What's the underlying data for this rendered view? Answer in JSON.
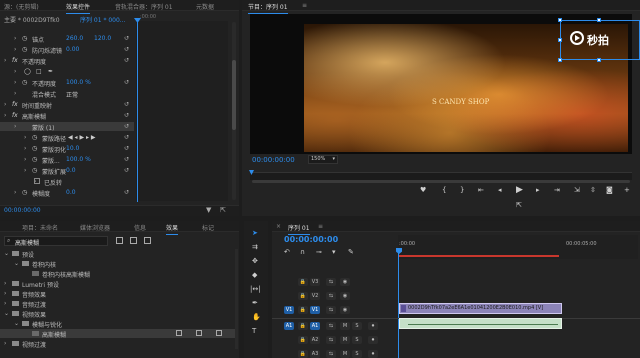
{
  "effect_controls": {
    "tabs": [
      "源：(无剪辑)",
      "效果控件",
      "音轨混合器：序列 01",
      "元数据"
    ],
    "source_label": "主要 * 0002D9Tfk0",
    "sequence_label": "序列 01 * 000...",
    "ruler_start": ":00:00",
    "rows": [
      {
        "indent": 14,
        "label": "锚点",
        "v1": "260.0",
        "v2": "120.0",
        "kind": "param"
      },
      {
        "indent": 14,
        "label": "防闪烁滤镜",
        "v1": "0.00",
        "v2": "",
        "kind": "param"
      },
      {
        "indent": 4,
        "label": "不透明度",
        "v1": "",
        "v2": "",
        "kind": "fx"
      },
      {
        "indent": 14,
        "label": "",
        "v1": "",
        "v2": "",
        "kind": "shapes"
      },
      {
        "indent": 14,
        "label": "不透明度",
        "v1": "100.0 %",
        "v2": "",
        "kind": "param"
      },
      {
        "indent": 14,
        "label": "混合模式",
        "v1": "正常",
        "v2": "",
        "kind": "dropdown"
      },
      {
        "indent": 4,
        "label": "时间重映射",
        "v1": "",
        "v2": "",
        "kind": "fx"
      },
      {
        "indent": 4,
        "label": "高斯模糊",
        "v1": "",
        "v2": "",
        "kind": "fx"
      },
      {
        "indent": 14,
        "label": "蒙版 (1)",
        "v1": "",
        "v2": "",
        "kind": "mask"
      },
      {
        "indent": 24,
        "label": "蒙版路径",
        "v1": "",
        "v2": "",
        "kind": "maskpath"
      },
      {
        "indent": 24,
        "label": "蒙版羽化",
        "v1": "10.0",
        "v2": "",
        "kind": "param"
      },
      {
        "indent": 24,
        "label": "蒙版...",
        "v1": "100.0 %",
        "v2": "",
        "kind": "param"
      },
      {
        "indent": 24,
        "label": "蒙版扩展",
        "v1": "0.0",
        "v2": "",
        "kind": "param"
      },
      {
        "indent": 34,
        "label": "已反转",
        "v1": "",
        "v2": "",
        "kind": "checkbox"
      },
      {
        "indent": 14,
        "label": "模糊度",
        "v1": "0.0",
        "v2": "",
        "kind": "param"
      }
    ],
    "bottom_time": "00:00:00:00"
  },
  "program_monitor": {
    "tab": "节目：序列 01",
    "timecode": "00:00:00:00",
    "zoom": "150%",
    "overlay_text": "S CANDY SHOP",
    "watermark_text": "秒拍"
  },
  "project_panel": {
    "tabs": [
      "项目：未命名",
      "媒体浏览器",
      "信息",
      "效果",
      "标记"
    ],
    "search_value": "高斯模糊",
    "tree": [
      {
        "indent": 4,
        "label": "预设",
        "level": 0,
        "open": true
      },
      {
        "indent": 14,
        "label": "卷积内核",
        "level": 1,
        "open": true
      },
      {
        "indent": 24,
        "label": "卷积内核高斯模糊",
        "level": 2,
        "open": false
      },
      {
        "indent": 4,
        "label": "Lumetri 预设",
        "level": 0,
        "open": false
      },
      {
        "indent": 4,
        "label": "音频效果",
        "level": 0,
        "open": false
      },
      {
        "indent": 4,
        "label": "音频过渡",
        "level": 0,
        "open": false
      },
      {
        "indent": 4,
        "label": "视频效果",
        "level": 0,
        "open": true
      },
      {
        "indent": 14,
        "label": "模糊与锐化",
        "level": 1,
        "open": true
      },
      {
        "indent": 24,
        "label": "高斯模糊",
        "level": 2,
        "open": false,
        "selected": true
      },
      {
        "indent": 4,
        "label": "视频过渡",
        "level": 0,
        "open": false
      }
    ]
  },
  "timeline": {
    "tab": "序列 01",
    "timecode": "00:00:00:00",
    "ruler_labels": [
      ":00:00",
      "00:00:05:00"
    ],
    "tracks": [
      {
        "name": "V3",
        "type": "video"
      },
      {
        "name": "V2",
        "type": "video"
      },
      {
        "name": "V1",
        "type": "video",
        "src": "V1"
      },
      {
        "name": "A1",
        "type": "audio",
        "src": "A1"
      },
      {
        "name": "A2",
        "type": "audio"
      },
      {
        "name": "A3",
        "type": "audio"
      }
    ],
    "clip_name": "0002D9hTfk07a2eE6A1e01041200E2B0E010.mp4 [V]"
  }
}
